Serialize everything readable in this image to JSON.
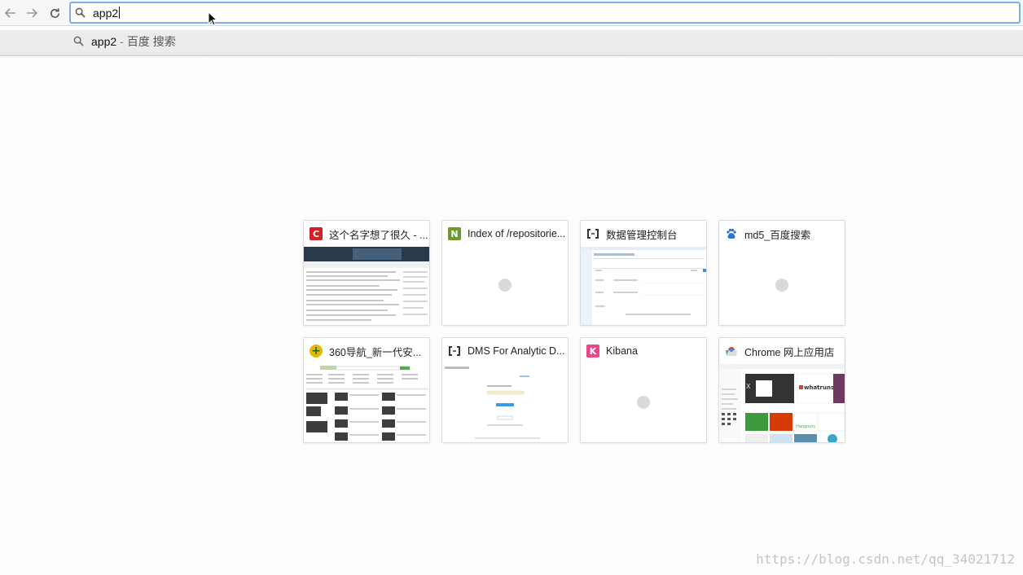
{
  "omnibox": {
    "value": "app2"
  },
  "suggestion": {
    "query": "app2",
    "separator": "-",
    "description": "百度 搜索"
  },
  "tiles": [
    {
      "title": "这个名字想了很久 - ...",
      "favicon_letter": "C",
      "favicon_color": "#d22128"
    },
    {
      "title": "Index of /repositorie...",
      "favicon_letter": "N",
      "favicon_color": "#6e9a2b"
    },
    {
      "title": "数据管理控制台",
      "favicon_letter": "[ ]",
      "favicon_color": "#333333"
    },
    {
      "title": "md5_百度搜索",
      "favicon_letter": "",
      "favicon_color": "#2f6fd6"
    },
    {
      "title": "360导航_新一代安...",
      "favicon_letter": "+",
      "favicon_color": "#e6b800"
    },
    {
      "title": "DMS For Analytic D...",
      "favicon_letter": "[ ]",
      "favicon_color": "#333333"
    },
    {
      "title": "Kibana",
      "favicon_letter": "K",
      "favicon_color": "#e8478b"
    },
    {
      "title": "Chrome 网上应用店",
      "favicon_letter": "",
      "favicon_color": "#4285f4"
    }
  ],
  "watermark": "https://blog.csdn.net/qq_34021712",
  "colors": {
    "omnibox_focus": "#7aaee8",
    "suggestion_bg": "#ececec"
  }
}
